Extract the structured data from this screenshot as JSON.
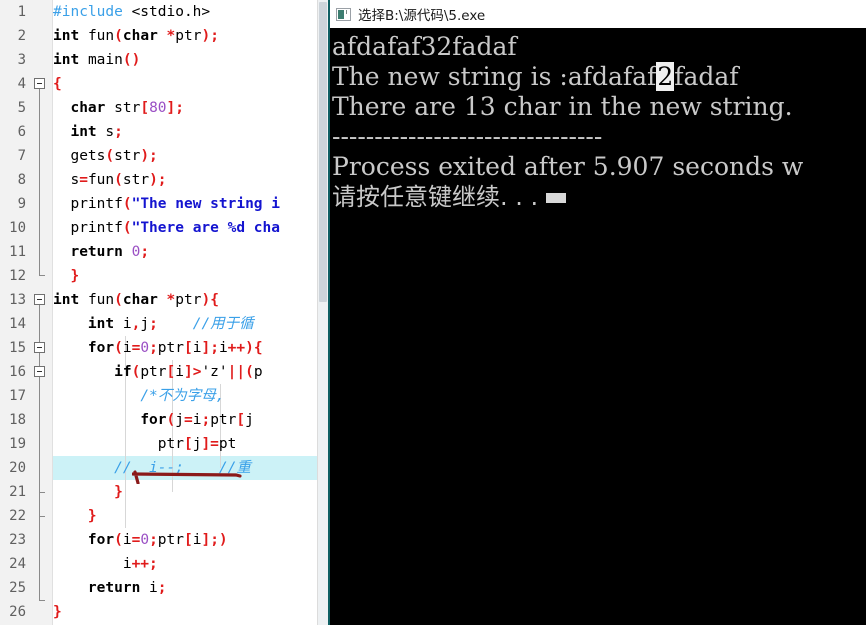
{
  "editor": {
    "name": "code-editor",
    "first_line": 1,
    "last_line": 26,
    "highlighted_line": 20,
    "line_numbers": [
      "1",
      "2",
      "3",
      "4",
      "5",
      "6",
      "7",
      "8",
      "9",
      "10",
      "11",
      "12",
      "13",
      "14",
      "15",
      "16",
      "17",
      "18",
      "19",
      "20",
      "21",
      "22",
      "23",
      "24",
      "25",
      "26"
    ],
    "lines": [
      {
        "n": 1,
        "text": "#include <stdio.h>"
      },
      {
        "n": 2,
        "text": "int fun(char *ptr);"
      },
      {
        "n": 3,
        "text": "int main()"
      },
      {
        "n": 4,
        "text": "{"
      },
      {
        "n": 5,
        "text": "  char str[80];"
      },
      {
        "n": 6,
        "text": "  int s;"
      },
      {
        "n": 7,
        "text": "  gets(str);"
      },
      {
        "n": 8,
        "text": "  s=fun(str);"
      },
      {
        "n": 9,
        "text": "  printf(\"The new string i"
      },
      {
        "n": 10,
        "text": "  printf(\"There are %d cha"
      },
      {
        "n": 11,
        "text": "  return 0;"
      },
      {
        "n": 12,
        "text": "  }"
      },
      {
        "n": 13,
        "text": "int fun(char *ptr){"
      },
      {
        "n": 14,
        "text": "    int i,j;     //用于循"
      },
      {
        "n": 15,
        "text": "    for(i=0;ptr[i];i++){"
      },
      {
        "n": 16,
        "text": "       if(ptr[i]>'z'||(p"
      },
      {
        "n": 17,
        "text": "          /*不为字母,"
      },
      {
        "n": 18,
        "text": "          for(j=i;ptr[j"
      },
      {
        "n": 19,
        "text": "            ptr[j]=pt"
      },
      {
        "n": 20,
        "text": "       //  i--;    //重"
      },
      {
        "n": 21,
        "text": "       }"
      },
      {
        "n": 22,
        "text": "    }"
      },
      {
        "n": 23,
        "text": "    for(i=0;ptr[i];)"
      },
      {
        "n": 24,
        "text": "        i++;"
      },
      {
        "n": 25,
        "text": "    return i;"
      },
      {
        "n": 26,
        "text": "}"
      }
    ],
    "annotation": {
      "name": "red-strikethrough-on-line-21",
      "color": "#8b1a1a"
    },
    "colors": {
      "background": "#ffffff",
      "gutter": "#f2f2f2",
      "line_number": "#606060",
      "highlight": "#ccf2f7",
      "keyword": "#000000",
      "punctuation": "#e01b1b",
      "number": "#9a4fc4",
      "string": "#1414d0",
      "comment": "#3aa0e8"
    }
  },
  "console": {
    "title": "选择B:\\源代码\\5.exe",
    "icon": "console-window-icon",
    "background": "#000000",
    "text_color": "#c9c9c9",
    "lines": [
      "afdafaf32fadaf",
      "The new string is :afdafaf2fadaf",
      "There are 13 char in the new string.",
      "--------------------------------",
      "Process exited after 5.907 seconds w",
      "请按任意键继续. . ."
    ],
    "output": {
      "input_echo": "afdafaf32fadaf",
      "result_prefix": "The new string is :afdafaf",
      "selected_char": "2",
      "result_suffix": "fadaf",
      "count_line": "There are 13 char in the new string.",
      "separator": "--------------------------------",
      "exit_line": "Process exited after 5.907 seconds w",
      "prompt": "请按任意键继续. . .",
      "char_count": "13",
      "exit_seconds": "5.907"
    },
    "cursor": "block-cursor"
  }
}
